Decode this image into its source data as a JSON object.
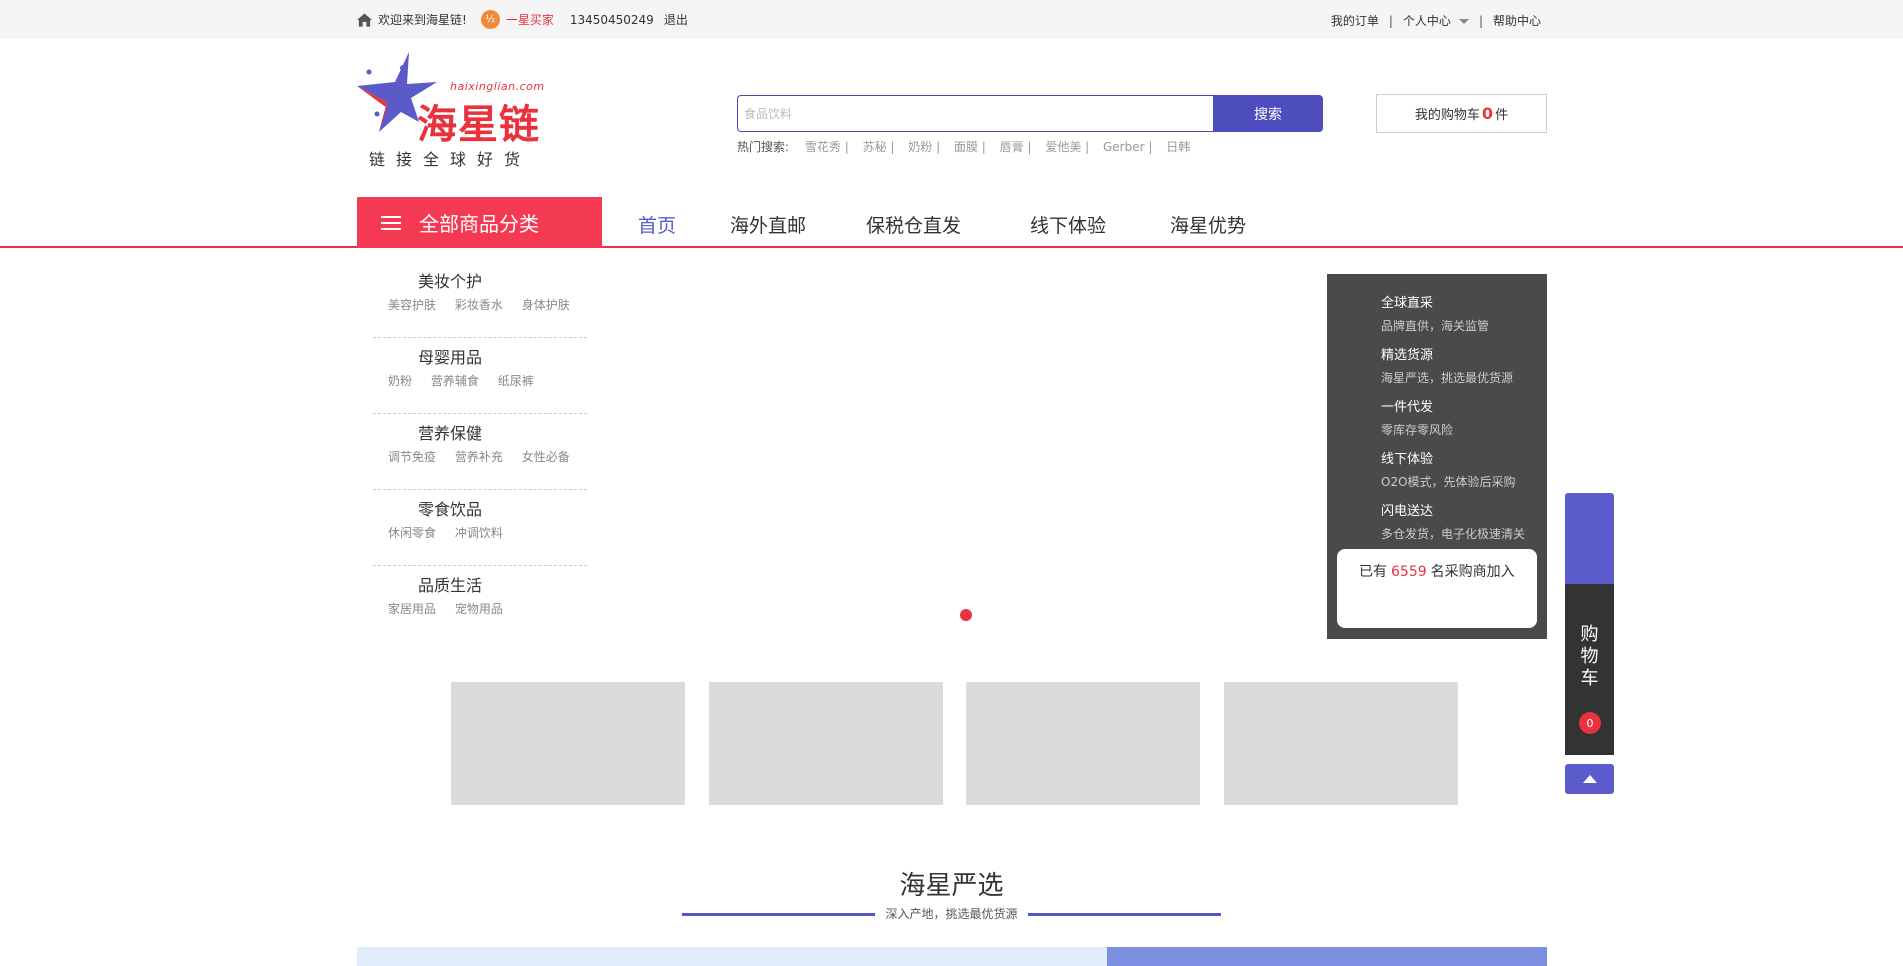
{
  "topbar": {
    "welcome": "欢迎来到海星链!",
    "member_level": "一星买家",
    "member_icon_text": "½",
    "phone": "13450450249",
    "logout": "退出",
    "my_orders": "我的订单",
    "personal_center": "个人中心",
    "help_center": "帮助中心",
    "separator": "|"
  },
  "logo": {
    "url_text": "haixinglian.com",
    "name": "海星链",
    "slogan": "链接全球好货"
  },
  "search": {
    "placeholder": "食品饮料",
    "button_label": "搜索",
    "hot_label": "热门搜索:",
    "hot_keywords": [
      "雪花秀 |",
      "苏秘 |",
      "奶粉 |",
      "面膜 |",
      "唇膏 |",
      "爱他美 |",
      "Gerber |",
      "日韩"
    ]
  },
  "cart": {
    "prefix": "我的购物车",
    "count": "0",
    "suffix": "件"
  },
  "nav": {
    "all_categories": "全部商品分类",
    "items": [
      "首页",
      "海外直邮",
      "保税仓直发",
      "线下体验",
      "海星优势"
    ]
  },
  "categories": [
    {
      "title": "美妆个护",
      "subs": [
        "美容护肤",
        "彩妆香水",
        "身体护肤"
      ]
    },
    {
      "title": "母婴用品",
      "subs": [
        "奶粉",
        "营养辅食",
        "纸尿裤"
      ]
    },
    {
      "title": "营养保健",
      "subs": [
        "调节免疫",
        "营养补充",
        "女性必备"
      ]
    },
    {
      "title": "零食饮品",
      "subs": [
        "休闲零食",
        "冲调饮料"
      ]
    },
    {
      "title": "品质生活",
      "subs": [
        "家居用品",
        "宠物用品"
      ]
    }
  ],
  "features": [
    {
      "title": "全球直采",
      "desc": "品牌直供，海关监管"
    },
    {
      "title": "精选货源",
      "desc": "海星严选，挑选最优货源"
    },
    {
      "title": "一件代发",
      "desc": "零库存零风险"
    },
    {
      "title": "线下体验",
      "desc": "O2O模式，先体验后采购"
    },
    {
      "title": "闪电送达",
      "desc": "多仓发货，电子化极速清关"
    }
  ],
  "join": {
    "prefix": "已有",
    "count": "6559",
    "suffix": "名采购商加入"
  },
  "side_cart": {
    "label": "购物车",
    "count": "0"
  },
  "section": {
    "title": "海星严选",
    "subtitle": "深入产地，挑选最优货源"
  },
  "colors": {
    "brand_red": "#e8333f",
    "brand_blue": "#4d4dbd",
    "dark_panel": "#4a4a4a"
  }
}
